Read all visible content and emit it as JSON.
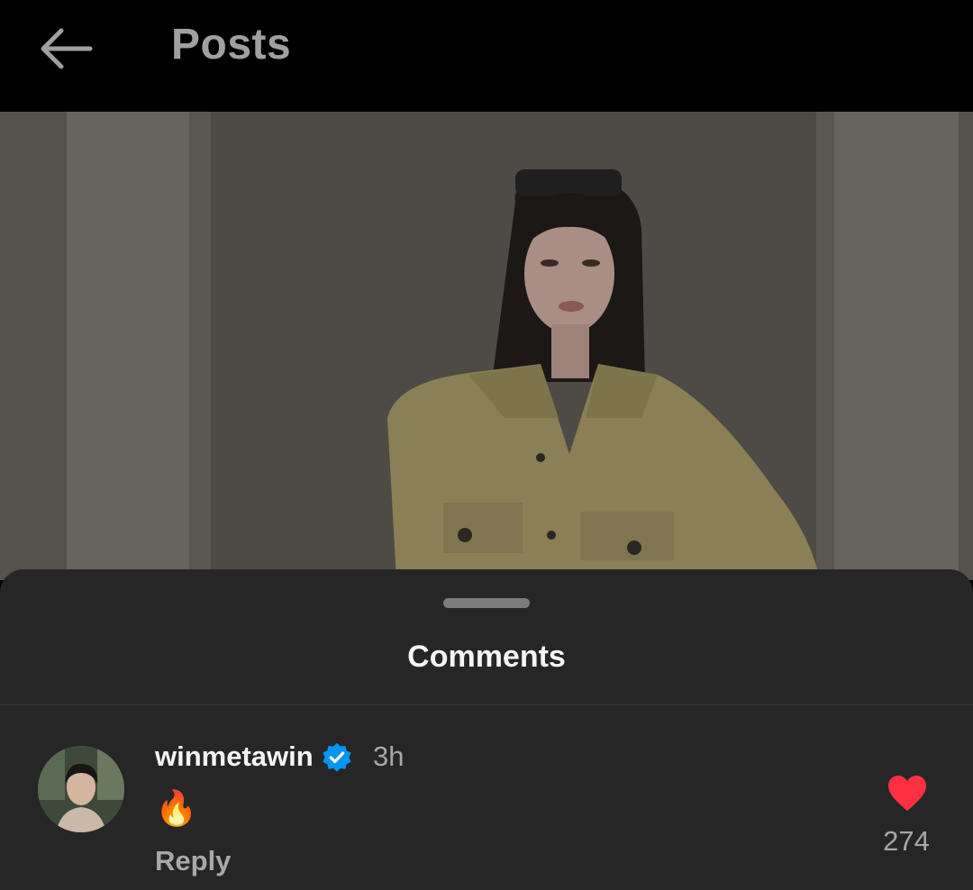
{
  "header": {
    "title": "Posts",
    "back_icon": "arrow-left-icon"
  },
  "post": {
    "image": "photo of a woman with sunglasses on her head wearing a khaki shirt, standing between concrete pillars"
  },
  "comments_sheet": {
    "title": "Comments",
    "comments": [
      {
        "username": "winmetawin",
        "verified": true,
        "time": "3h",
        "text": "🔥",
        "reply_label": "Reply",
        "like_count": "274",
        "liked": true
      }
    ]
  },
  "colors": {
    "like": "#ff3040",
    "verified": "#0095f6",
    "sheet_bg": "#262626"
  }
}
